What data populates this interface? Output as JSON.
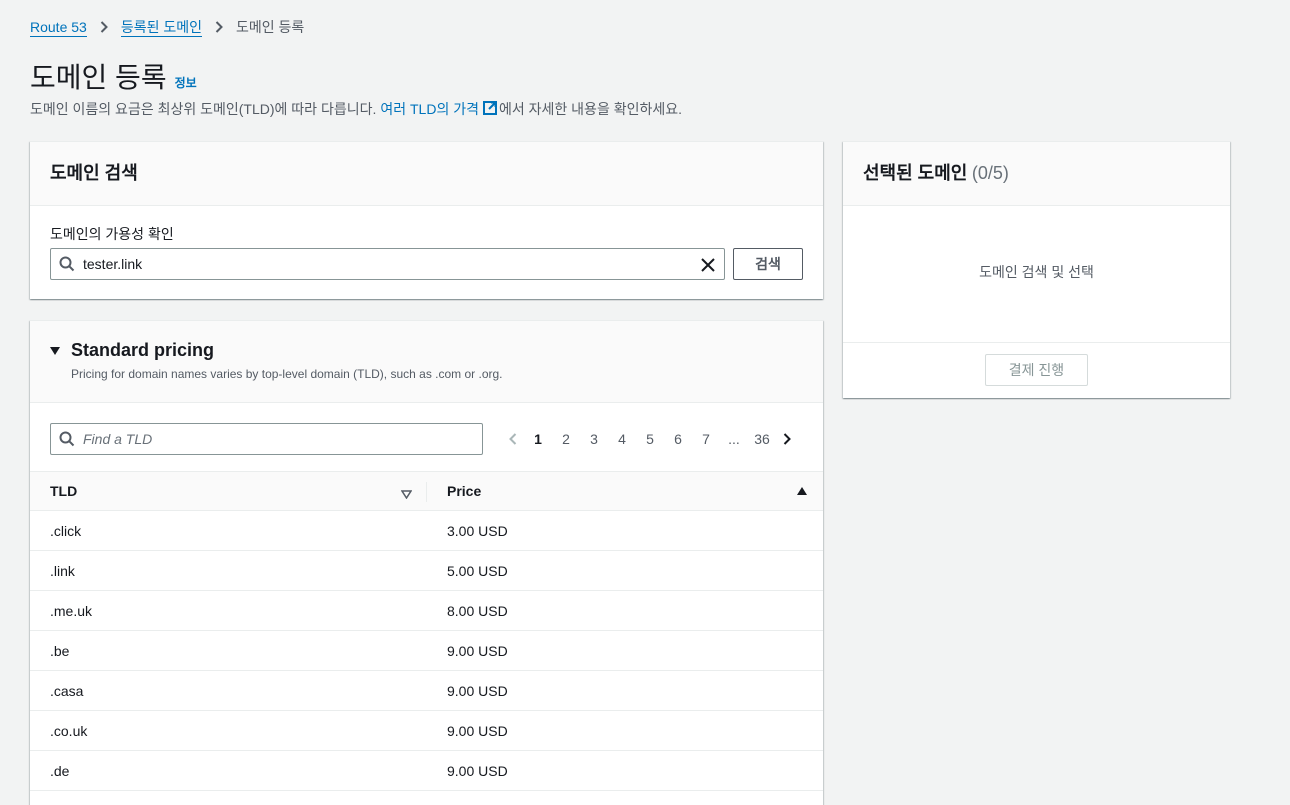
{
  "breadcrumb": {
    "items": [
      "Route 53",
      "등록된 도메인"
    ],
    "current": "도메인 등록"
  },
  "header": {
    "title": "도메인 등록",
    "info_link": "정보",
    "desc_before": "도메인 이름의 요금은 최상위 도메인(TLD)에 따라 다릅니다.",
    "desc_link": "여러 TLD의 가격",
    "desc_after": "에서 자세한 내용을 확인하세요."
  },
  "search_panel": {
    "title": "도메인 검색",
    "field_label": "도메인의 가용성 확인",
    "search_value": "tester.link",
    "search_button": "검색"
  },
  "selected_panel": {
    "title": "선택된 도메인",
    "count": "(0/5)",
    "empty_message": "도메인 검색 및 선택",
    "checkout_button": "결제 진행"
  },
  "pricing": {
    "title": "Standard pricing",
    "description": "Pricing for domain names varies by top-level domain (TLD), such as .com or .org.",
    "filter_placeholder": "Find a TLD",
    "pages": [
      "1",
      "2",
      "3",
      "4",
      "5",
      "6",
      "7",
      "...",
      "36"
    ],
    "active_page": "1",
    "columns": {
      "tld": "TLD",
      "price": "Price"
    },
    "rows": [
      {
        "tld": ".click",
        "price": "3.00 USD"
      },
      {
        "tld": ".link",
        "price": "5.00 USD"
      },
      {
        "tld": ".me.uk",
        "price": "8.00 USD"
      },
      {
        "tld": ".be",
        "price": "9.00 USD"
      },
      {
        "tld": ".casa",
        "price": "9.00 USD"
      },
      {
        "tld": ".co.uk",
        "price": "9.00 USD"
      },
      {
        "tld": ".de",
        "price": "9.00 USD"
      }
    ]
  },
  "colors": {
    "link": "#0073bb",
    "background": "#f2f3f3",
    "text": "#16191f",
    "muted": "#545b64"
  }
}
